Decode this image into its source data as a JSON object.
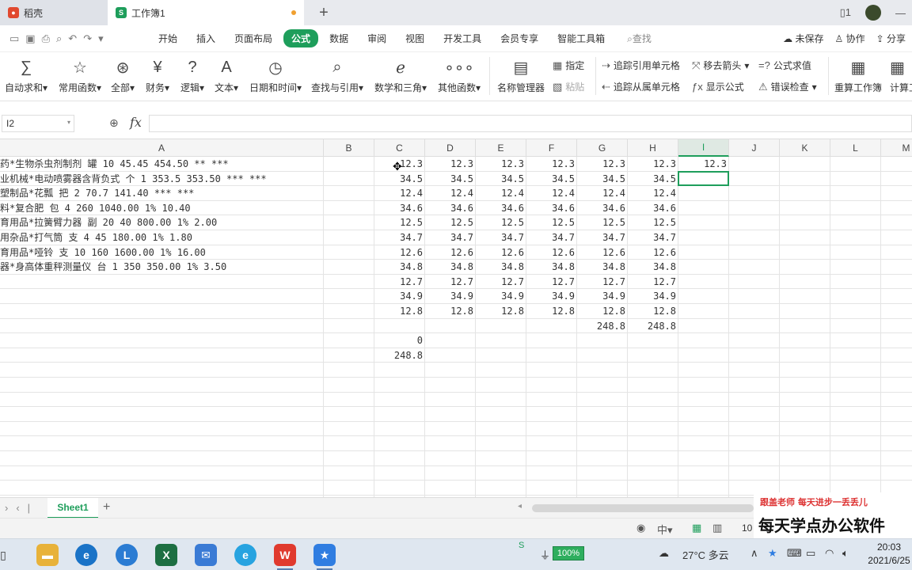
{
  "titlebar": {
    "app_tab": "稻壳",
    "workbook_tab": "工作簿1",
    "new_tab": "+"
  },
  "quick_access": [
    "save-icon",
    "undo-icon",
    "redo-icon"
  ],
  "menu": {
    "items": [
      "开始",
      "插入",
      "页面布局",
      "公式",
      "数据",
      "审阅",
      "视图",
      "开发工具",
      "会员专享",
      "智能工具箱"
    ],
    "active": "公式",
    "search": "查找",
    "unsaved": "未保存",
    "collab": "协作",
    "share": "分享"
  },
  "ribbon": {
    "autosum": "自动求和",
    "common": "常用函数",
    "all": "全部",
    "finance": "财务",
    "logic": "逻辑",
    "text": "文本",
    "datetime": "日期和时间",
    "lookup": "查找与引用",
    "math": "数学和三角",
    "other": "其他函数",
    "names": "名称管理器",
    "assign": "指定",
    "paste": "粘贴",
    "trace_prec": "追踪引用单元格",
    "trace_dep": "追踪从属单元格",
    "remove_arrows": "移去箭头",
    "show_formula": "显示公式",
    "eval": "公式求值",
    "error_check": "错误检查",
    "recalc_book": "重算工作簿",
    "calc_sheet": "计算工"
  },
  "formula_bar": {
    "name_box": "I2",
    "fx": "fx",
    "value": ""
  },
  "columns": [
    "A",
    "B",
    "C",
    "D",
    "E",
    "F",
    "G",
    "H",
    "I",
    "J",
    "K",
    "L",
    "M"
  ],
  "selected_column": "I",
  "rows": [
    {
      "a": "药*生物杀虫剂制剂 罐 10 45.45 454.50 ** ***",
      "c": "12.3",
      "d": "12.3",
      "e": "12.3",
      "f": "12.3",
      "g": "12.3",
      "h": "12.3",
      "i": "12.3"
    },
    {
      "a": "业机械*电动喷雾器含背负式 个 1 353.5 353.50 *** ***",
      "c": "34.5",
      "d": "34.5",
      "e": "34.5",
      "f": "34.5",
      "g": "34.5",
      "h": "34.5",
      "i": ""
    },
    {
      "a": "塑制品*花瓢 把 2 70.7 141.40 *** ***",
      "c": "12.4",
      "d": "12.4",
      "e": "12.4",
      "f": "12.4",
      "g": "12.4",
      "h": "12.4",
      "i": ""
    },
    {
      "a": "料*复合肥 包 4 260 1040.00 1% 10.40",
      "c": "34.6",
      "d": "34.6",
      "e": "34.6",
      "f": "34.6",
      "g": "34.6",
      "h": "34.6",
      "i": ""
    },
    {
      "a": "育用品*拉簧臂力器 副 20 40 800.00 1% 2.00",
      "c": "12.5",
      "d": "12.5",
      "e": "12.5",
      "f": "12.5",
      "g": "12.5",
      "h": "12.5",
      "i": ""
    },
    {
      "a": "用杂品*打气筒 支 4 45 180.00 1% 1.80",
      "c": "34.7",
      "d": "34.7",
      "e": "34.7",
      "f": "34.7",
      "g": "34.7",
      "h": "34.7",
      "i": ""
    },
    {
      "a": "育用品*哑铃 支 10 160 1600.00 1% 16.00",
      "c": "12.6",
      "d": "12.6",
      "e": "12.6",
      "f": "12.6",
      "g": "12.6",
      "h": "12.6",
      "i": ""
    },
    {
      "a": "器*身高体重秤测量仪 台 1 350 350.00 1% 3.50",
      "c": "34.8",
      "d": "34.8",
      "e": "34.8",
      "f": "34.8",
      "g": "34.8",
      "h": "34.8",
      "i": ""
    },
    {
      "a": "",
      "c": "12.7",
      "d": "12.7",
      "e": "12.7",
      "f": "12.7",
      "g": "12.7",
      "h": "12.7",
      "i": ""
    },
    {
      "a": "",
      "c": "34.9",
      "d": "34.9",
      "e": "34.9",
      "f": "34.9",
      "g": "34.9",
      "h": "34.9",
      "i": ""
    },
    {
      "a": "",
      "c": "12.8",
      "d": "12.8",
      "e": "12.8",
      "f": "12.8",
      "g": "12.8",
      "h": "12.8",
      "i": ""
    },
    {
      "a": "",
      "c": "",
      "d": "",
      "e": "",
      "f": "",
      "g": "248.8",
      "h": "248.8",
      "i": ""
    },
    {
      "a": "",
      "c": "0",
      "d": "",
      "e": "",
      "f": "",
      "g": "",
      "h": "",
      "i": ""
    },
    {
      "a": "",
      "c": "248.8",
      "d": "",
      "e": "",
      "f": "",
      "g": "",
      "h": "",
      "i": ""
    }
  ],
  "sheet": {
    "name": "Sheet1",
    "add": "+"
  },
  "status": {
    "zoom": "10"
  },
  "taskbar": {
    "battery": "100%",
    "weather": "27°C 多云",
    "time": "20:03",
    "date": "2021/6/25"
  },
  "watermark": {
    "line1": "跟盖老师  每天进步一丢丢儿",
    "line2": "每天学点办公软件"
  },
  "colors": {
    "accent": "#1e9e5b",
    "selection": "#1e9e5b"
  }
}
